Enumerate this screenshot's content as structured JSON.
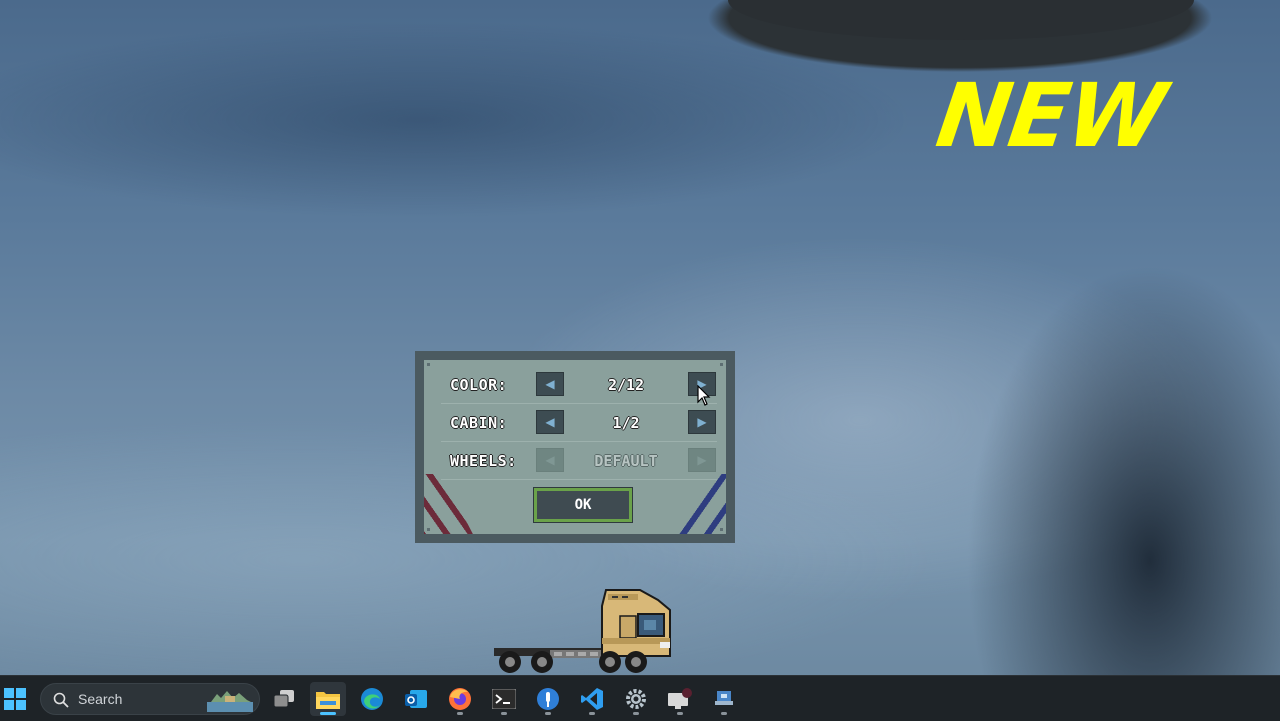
{
  "overlay": {
    "new_label": "NEW"
  },
  "dialog": {
    "rows": [
      {
        "label": "COLOR:",
        "value": "2/12"
      },
      {
        "label": "CABIN:",
        "value": "1/2"
      },
      {
        "label": "WHEELS:",
        "value": "DEFAULT"
      }
    ],
    "ok_label": "OK"
  },
  "taskbar": {
    "search_placeholder": "Search",
    "apps": [
      {
        "name": "start-icon"
      },
      {
        "name": "task-view-icon"
      },
      {
        "name": "file-explorer-icon"
      },
      {
        "name": "edge-icon"
      },
      {
        "name": "outlook-icon"
      },
      {
        "name": "firefox-icon"
      },
      {
        "name": "terminal-icon"
      },
      {
        "name": "pin-app-icon"
      },
      {
        "name": "vscode-icon"
      },
      {
        "name": "settings-icon"
      },
      {
        "name": "remote-desktop-icon"
      },
      {
        "name": "app-window-icon"
      }
    ]
  },
  "colors": {
    "accent": "#ffff00",
    "dialog_bg": "#8aa09c",
    "dialog_border": "#4b5a60",
    "ok_border": "#6aa24a",
    "taskbar_bg": "#1e2327",
    "truck_cab": "#d8b878"
  }
}
